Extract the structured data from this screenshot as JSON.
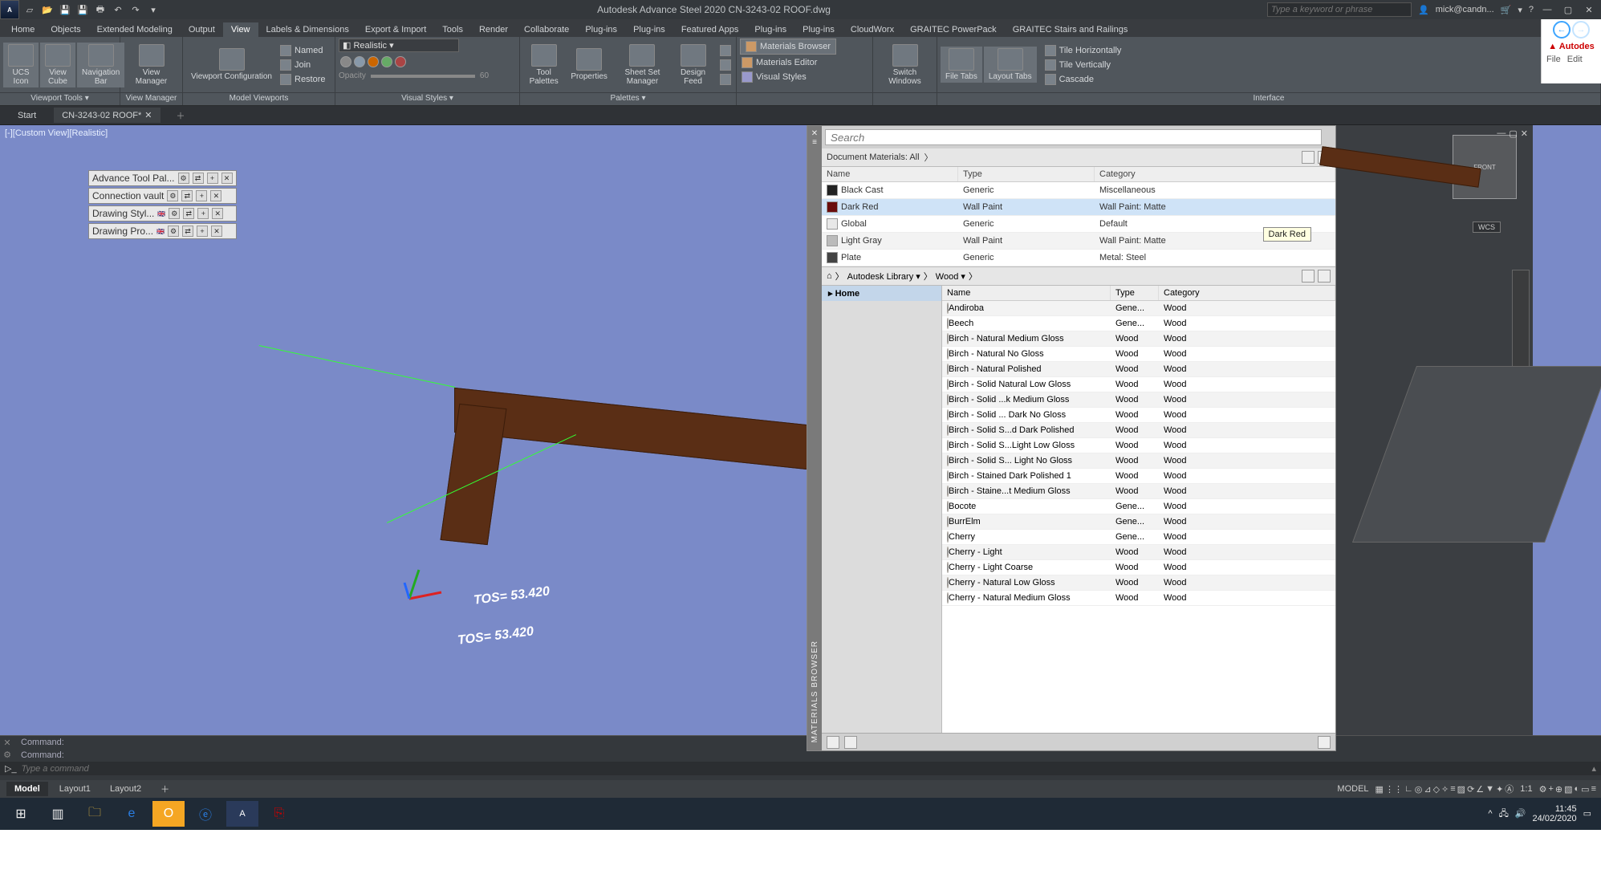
{
  "app": {
    "title": "Autodesk Advance Steel 2020   CN-3243-02 ROOF.dwg",
    "search_ph": "Type a keyword or phrase",
    "user": "mick@candn..."
  },
  "qat": [
    "new",
    "open",
    "save",
    "saveas",
    "plot",
    "undo",
    "redo",
    "down"
  ],
  "tabs": [
    "Home",
    "Objects",
    "Extended Modeling",
    "Output",
    "View",
    "Labels & Dimensions",
    "Export & Import",
    "Tools",
    "Render",
    "Collaborate",
    "Plug-ins",
    "Plug-ins",
    "Featured Apps",
    "Plug-ins",
    "Plug-ins",
    "CloudWorx",
    "GRAITEC PowerPack",
    "GRAITEC Stairs and Railings"
  ],
  "tabs_active": "View",
  "ribbon": {
    "viewport_tools": {
      "title": "Viewport Tools ▾",
      "btns": [
        "UCS Icon",
        "View Cube",
        "Navigation Bar"
      ]
    },
    "view_manager": {
      "title": "View Manager",
      "btns": [
        "View Manager"
      ]
    },
    "model_viewports": {
      "title": "Model Viewports",
      "btns": [
        "Viewport Configuration"
      ],
      "items": [
        "Named",
        "Join",
        "Restore"
      ]
    },
    "visual_styles": {
      "title": "Visual Styles ▾",
      "dropdown": "Realistic",
      "opacity_label": "Opacity",
      "opacity_val": "60"
    },
    "palettes": {
      "title": "Palettes ▾",
      "btns": [
        "Tool Palettes",
        "Properties",
        "Sheet Set Manager",
        "Design Feed"
      ]
    },
    "materials": {
      "browser": "Materials Browser",
      "editor": "Materials Editor",
      "vstyles": "Visual Styles"
    },
    "windows": {
      "title": "",
      "btns": [
        "Switch Windows",
        "File Tabs",
        "Layout Tabs"
      ],
      "tiles": [
        "Tile Horizontally",
        "Tile Vertically",
        "Cascade"
      ],
      "interface": "Interface"
    }
  },
  "filetabs": {
    "start": "Start",
    "doc": "CN-3243-02 ROOF*"
  },
  "viewport_label": "[-][Custom View][Realistic]",
  "tos1": "TOS= 53.420",
  "tos2": "TOS= 53.420",
  "palettes": [
    "Advance Tool Pal...",
    "Connection vault",
    "Drawing Styl...",
    "Drawing Pro..."
  ],
  "mat": {
    "title": "MATERIALS BROWSER",
    "search_ph": "Search",
    "crumb": "Document Materials: All",
    "cols": [
      "Name",
      "Type",
      "Category"
    ],
    "rows": [
      {
        "name": "Black Cast",
        "type": "Generic",
        "cat": "Miscellaneous",
        "sw": "#222"
      },
      {
        "name": "Dark Red",
        "type": "Wall Paint",
        "cat": "Wall Paint: Matte",
        "sw": "#6a0d0d",
        "sel": true
      },
      {
        "name": "Global",
        "type": "Generic",
        "cat": "Default",
        "sw": "#e8e8e8"
      },
      {
        "name": "Light Gray",
        "type": "Wall Paint",
        "cat": "Wall Paint: Matte",
        "sw": "#bbb"
      },
      {
        "name": "Plate",
        "type": "Generic",
        "cat": "Metal: Steel",
        "sw": "#444"
      }
    ],
    "tooltip": "Dark Red",
    "libcrumb": [
      "Autodesk Library ▾",
      "Wood ▾"
    ],
    "tree": "Home",
    "libcols": [
      "Name",
      "Type",
      "Category"
    ],
    "librows": [
      {
        "name": "Andiroba",
        "type": "Gene...",
        "cat": "Wood"
      },
      {
        "name": "Beech",
        "type": "Gene...",
        "cat": "Wood"
      },
      {
        "name": "Birch - Natural Medium Gloss",
        "type": "Wood",
        "cat": "Wood"
      },
      {
        "name": "Birch - Natural No Gloss",
        "type": "Wood",
        "cat": "Wood"
      },
      {
        "name": "Birch - Natural Polished",
        "type": "Wood",
        "cat": "Wood"
      },
      {
        "name": "Birch - Solid Natural Low Gloss",
        "type": "Wood",
        "cat": "Wood"
      },
      {
        "name": "Birch - Solid ...k Medium Gloss",
        "type": "Wood",
        "cat": "Wood"
      },
      {
        "name": "Birch - Solid ... Dark No Gloss",
        "type": "Wood",
        "cat": "Wood"
      },
      {
        "name": "Birch - Solid S...d Dark Polished",
        "type": "Wood",
        "cat": "Wood"
      },
      {
        "name": "Birch - Solid S...Light Low Gloss",
        "type": "Wood",
        "cat": "Wood"
      },
      {
        "name": "Birch - Solid S... Light No Gloss",
        "type": "Wood",
        "cat": "Wood"
      },
      {
        "name": "Birch - Stained Dark Polished 1",
        "type": "Wood",
        "cat": "Wood"
      },
      {
        "name": "Birch - Staine...t Medium Gloss",
        "type": "Wood",
        "cat": "Wood"
      },
      {
        "name": "Bocote",
        "type": "Gene...",
        "cat": "Wood"
      },
      {
        "name": "BurrElm",
        "type": "Gene...",
        "cat": "Wood"
      },
      {
        "name": "Cherry",
        "type": "Gene...",
        "cat": "Wood"
      },
      {
        "name": "Cherry - Light",
        "type": "Wood",
        "cat": "Wood"
      },
      {
        "name": "Cherry - Light Coarse",
        "type": "Wood",
        "cat": "Wood"
      },
      {
        "name": "Cherry - Natural Low Gloss",
        "type": "Wood",
        "cat": "Wood"
      },
      {
        "name": "Cherry - Natural Medium Gloss",
        "type": "Wood",
        "cat": "Wood"
      }
    ]
  },
  "wcs": "WCS",
  "cmd": {
    "hist1": "Command:",
    "hist2": "Command:",
    "prompt": "Type a command"
  },
  "layouts": [
    "Model",
    "Layout1",
    "Layout2"
  ],
  "status_model": "MODEL",
  "status_scale": "1:1",
  "rightpanel": {
    "brand": "Autodes",
    "file": "File",
    "edit": "Edit"
  },
  "clock": {
    "time": "11:45",
    "date": "24/02/2020"
  }
}
